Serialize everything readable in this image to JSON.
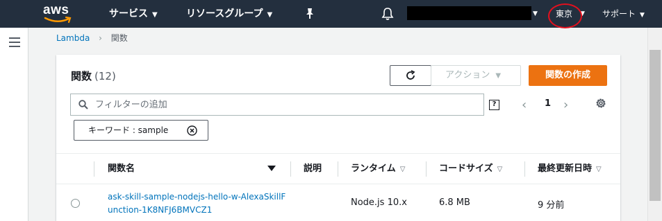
{
  "topnav": {
    "logo_text": "aws",
    "services_label": "サービス",
    "resource_groups_label": "リソースグループ",
    "account_name": "",
    "region_label": "東京",
    "support_label": "サポート",
    "caret_glyph": "⌄",
    "colors": {
      "background": "#232f3e",
      "region_highlight": "#e3101e"
    }
  },
  "breadcrumb": {
    "items": [
      "Lambda",
      "関数"
    ],
    "separator": "›"
  },
  "panel": {
    "title": "関数",
    "count": "(12)",
    "actions_label": "アクション",
    "create_label": "関数の作成",
    "filter_placeholder": "フィルターの追加",
    "filter_value": "",
    "help_glyph": "?",
    "page_number": "1",
    "prev_glyph": "‹",
    "next_glyph": "›",
    "filter_token": "キーワード : sample",
    "colors": {
      "primary_button": "#ec7211",
      "link": "#0073bb"
    }
  },
  "table": {
    "columns": [
      "関数名",
      "説明",
      "ランタイム",
      "コードサイズ",
      "最終更新日時"
    ],
    "sort_glyph": "▽",
    "rows": [
      {
        "name": "ask-skill-sample-nodejs-hello-w-AlexaSkillFunction-1K8NFJ6BMVCZ1",
        "description": "",
        "runtime": "Node.js 10.x",
        "code_size": "6.8 MB",
        "last_modified": "9 分前"
      }
    ]
  }
}
